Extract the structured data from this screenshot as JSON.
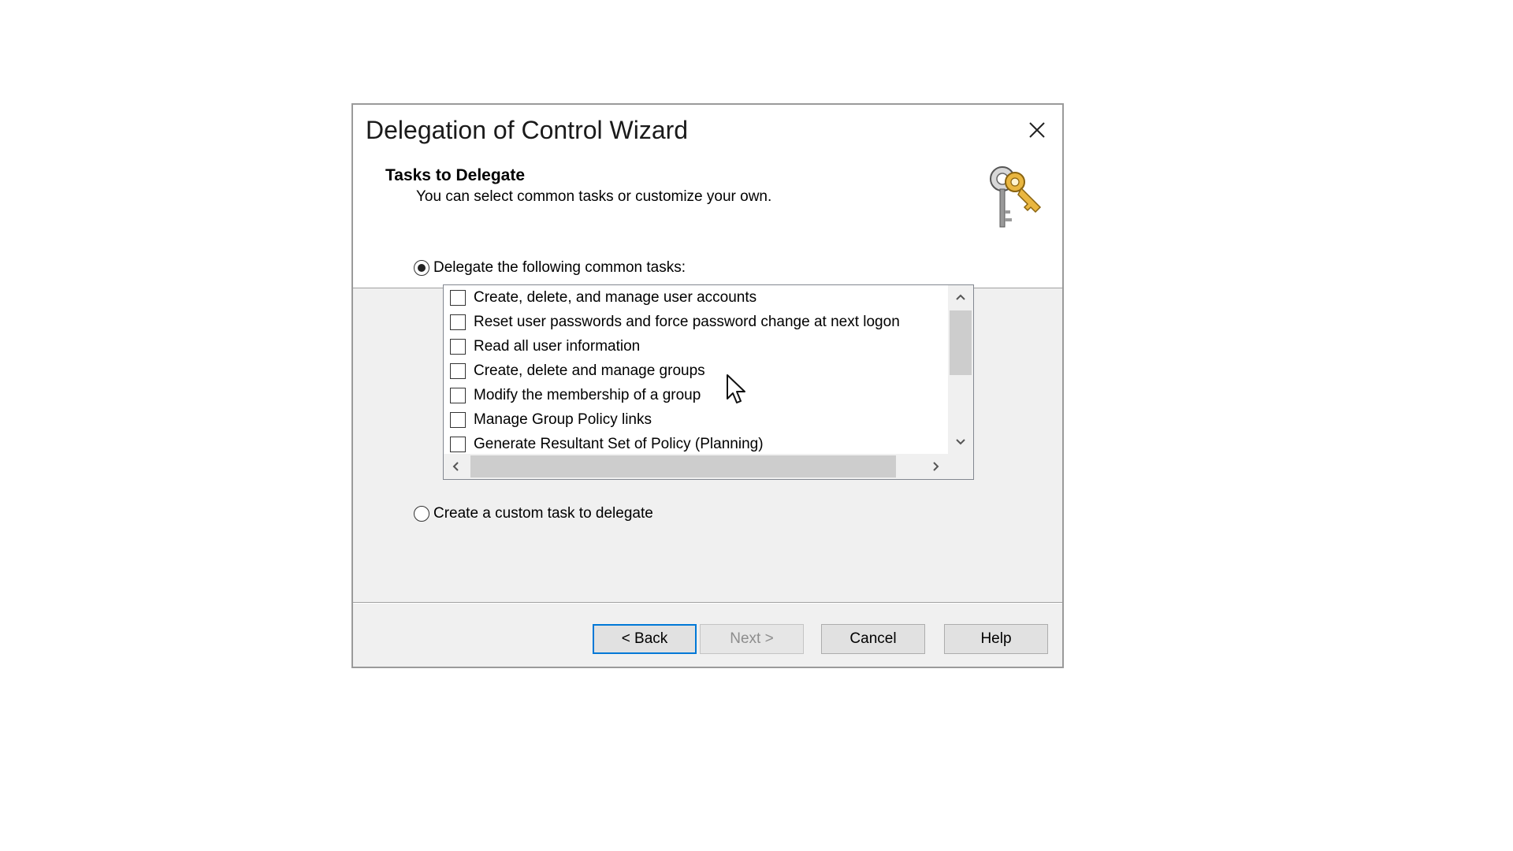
{
  "window": {
    "title": "Delegation of Control Wizard",
    "close_icon": "close-icon"
  },
  "header": {
    "title": "Tasks to Delegate",
    "subtitle": "You can select common tasks or customize your own.",
    "icon": "keys-icon"
  },
  "options": {
    "common_label": "Delegate the following common tasks:",
    "common_selected": true,
    "custom_label": "Create a custom task to delegate",
    "custom_selected": false
  },
  "tasks": [
    {
      "label": "Create, delete, and manage user accounts",
      "checked": false
    },
    {
      "label": "Reset user passwords and force password change at next logon",
      "checked": false
    },
    {
      "label": "Read all user information",
      "checked": false
    },
    {
      "label": "Create, delete and manage groups",
      "checked": false
    },
    {
      "label": "Modify the membership of a group",
      "checked": false
    },
    {
      "label": "Manage Group Policy links",
      "checked": false
    },
    {
      "label": "Generate Resultant Set of Policy (Planning)",
      "checked": false
    }
  ],
  "buttons": {
    "back": "< Back",
    "next": "Next >",
    "cancel": "Cancel",
    "help": "Help"
  },
  "colors": {
    "default_button_border": "#0078d7",
    "dialog_background": "#f0f0f0"
  }
}
